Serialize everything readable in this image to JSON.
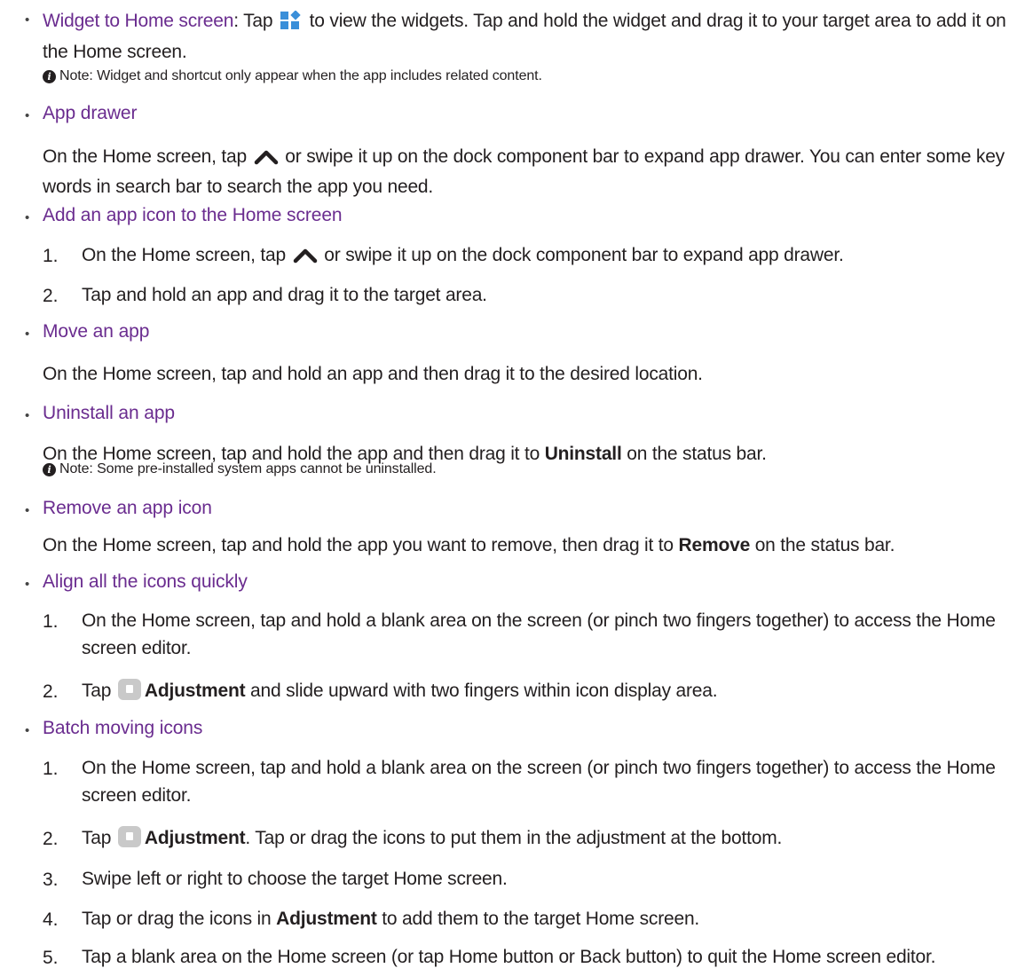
{
  "widget": {
    "title": "Widget to Home screen",
    "text_a": ": Tap ",
    "text_b": " to view the widgets. Tap and hold the widget and drag it to your target area to add it on the Home screen.",
    "icon": "widgets-icon"
  },
  "note1": "Note: Widget and shortcut only appear when the app includes related content.",
  "app_drawer": {
    "title": "App drawer",
    "text_a": "On the Home screen, tap ",
    "text_b": " or swipe it up on the dock component bar to expand app drawer. You can enter some key words in search bar to search the app you need.",
    "icon": "chevron-up-icon"
  },
  "add_icon": {
    "title": "Add an app icon to the Home screen",
    "steps": [
      {
        "num": "1.",
        "text_a": "On the Home screen, tap ",
        "text_b": " or swipe it up on the dock component bar to expand app drawer."
      },
      {
        "num": "2.",
        "text": "Tap and hold an app and drag it to the target area."
      }
    ]
  },
  "move_app": {
    "title": "Move an app",
    "text": "On the Home screen, tap and hold an app and then drag it to the desired location."
  },
  "uninstall": {
    "title": "Uninstall an app",
    "text_a": "On the Home screen, tap and hold the app and then drag it to ",
    "bold": "Uninstall",
    "text_b": " on the status bar.",
    "note": "Note:  Some pre-installed system apps cannot be uninstalled."
  },
  "remove_icon": {
    "title": "Remove an app icon",
    "text_a": "On the Home screen, tap and hold the app you want to remove, then drag it to ",
    "bold": "Remove",
    "text_b": " on the status bar."
  },
  "align": {
    "title": "Align all the icons quickly",
    "steps": [
      {
        "num": "1.",
        "text": "On the Home screen, tap and hold a blank area on the screen (or pinch two fingers together) to access the Home screen editor."
      },
      {
        "num": "2.",
        "text_a": "Tap ",
        "bold": "Adjustment",
        "text_b": " and slide upward with two fingers within icon display area."
      }
    ]
  },
  "batch": {
    "title": "Batch moving icons",
    "steps": [
      {
        "num": "1.",
        "text": "On the Home screen, tap and hold a blank area on the screen (or pinch two fingers together) to access the Home screen editor."
      },
      {
        "num": "2.",
        "text_a": "Tap ",
        "bold": "Adjustment",
        "text_b": ". Tap or drag the icons to put them in the adjustment at the bottom."
      },
      {
        "num": "3.",
        "text": "Swipe left or right to choose the target Home screen."
      },
      {
        "num": "4.",
        "text_a": "Tap or drag the icons in ",
        "bold": "Adjustment",
        "text_b": " to add them to the target Home screen."
      },
      {
        "num": "5.",
        "text": "Tap a blank area on the Home screen (or tap Home button or Back button) to quit the Home screen editor."
      }
    ]
  },
  "bullet_char": "•",
  "colors": {
    "heading": "#6a2c8f",
    "body": "#231f20"
  }
}
